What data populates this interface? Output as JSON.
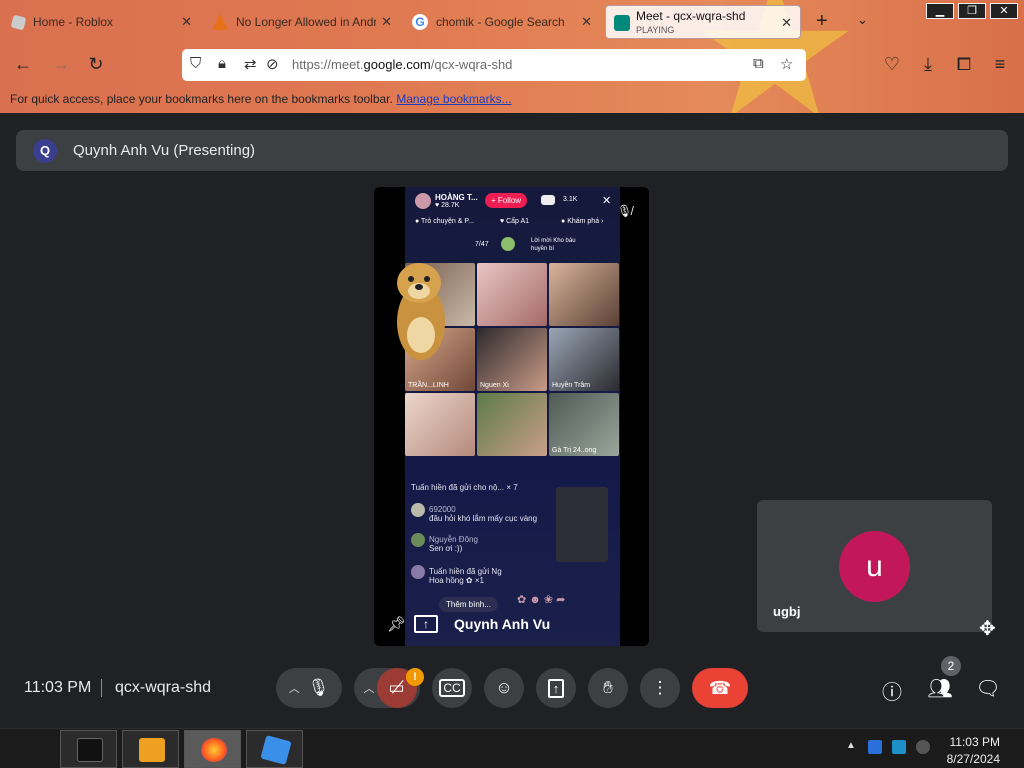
{
  "browser": {
    "tabs": [
      {
        "title": "Home - Roblox",
        "close": "✕"
      },
      {
        "title": "No Longer Allowed in Andr",
        "close": "✕"
      },
      {
        "title": "chomik - Google Search",
        "close": "✕"
      },
      {
        "title": "Meet - qcx-wqra-shd",
        "subtitle": "PLAYING",
        "close": "✕"
      }
    ],
    "new_tab": "+",
    "tab_list": "⌄",
    "url": {
      "prefix": "https://meet.",
      "domain": "google.com",
      "path": "/qcx-wqra-shd"
    },
    "bookmarks_text": "For quick access, place your bookmarks here on the bookmarks toolbar.",
    "bookmarks_link": "Manage bookmarks..."
  },
  "meet": {
    "presenter_initial": "Q",
    "presenter_banner": "Quynh Anh Vu (Presenting)",
    "main_tile_name": "Quynh Anh Vu",
    "self_initial": "u",
    "self_name": "ugbj",
    "time": "11:03 PM",
    "meeting_code": "qcx-wqra-shd",
    "camera_warning": "!",
    "participant_count": "2"
  },
  "stream": {
    "host_name": "HOÀNG T...",
    "host_likes": "♥ 28.7K",
    "follow": "+ Follow",
    "viewers": "3.1K",
    "close": "✕",
    "categories": [
      "Trò chuyện & P...",
      "Cấp A1",
      "Khám phá ›"
    ],
    "rank": "7/47",
    "prize": "Lời mời Kho báu huyền bí",
    "cells": [
      "",
      "",
      "",
      "TRẦN...LINH",
      "Nguen Xi",
      "Huyền Trâm",
      "",
      "",
      "Gà Trị 24..ong"
    ],
    "chat": [
      {
        "name": "Tuấn hiền đã gửi cho nộ...",
        "msg": "× 7"
      },
      {
        "name": "692000",
        "msg": "đâu hỏi  khó lắm mấy cục vàng"
      },
      {
        "name": "Nguyễn Đông",
        "msg": "Sen ơi :))"
      },
      {
        "name": "Tuấn hiền đã gửi Ng",
        "msg": "Hoa hồng ✿ ×1"
      }
    ],
    "comment_placeholder": "Thêm bình..."
  },
  "taskbar": {
    "clock_time": "11:03 PM",
    "clock_date": "8/27/2024",
    "tray_arrow": "▲"
  },
  "colors": {
    "meet_bg": "#202124",
    "leave_red": "#ea4335",
    "avatar_pink": "#c2185b",
    "camera_off_red": "#9c3a34",
    "warning_orange": "#f29900"
  }
}
